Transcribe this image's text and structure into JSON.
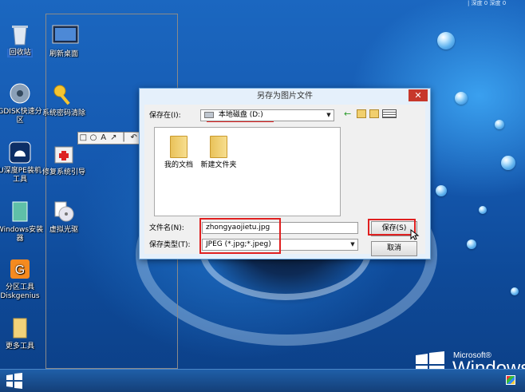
{
  "topbar": {
    "text": "| 深度 0 深度 0"
  },
  "desktop_icons": [
    {
      "label": "回收站",
      "icon": "recycle-bin-icon"
    },
    {
      "label": "刷新桌面",
      "icon": "refresh-desktop-icon"
    },
    {
      "label": "GDISK快速分区",
      "icon": "gdisk-icon"
    },
    {
      "label": "系统密码清除",
      "icon": "key-icon"
    },
    {
      "label": "U深度PE装机工具",
      "icon": "pe-installer-icon"
    },
    {
      "label": "修复系统引导",
      "icon": "repair-boot-icon"
    },
    {
      "label": "Windows安装器",
      "icon": "windows-installer-icon"
    },
    {
      "label": "虚拟光驱",
      "icon": "virtual-drive-icon"
    },
    {
      "label": "分区工具Diskgenius",
      "icon": "diskgenius-icon"
    },
    {
      "label": "更多工具",
      "icon": "more-tools-icon"
    }
  ],
  "toolbar": {
    "tools": [
      "□",
      "○",
      "A",
      "↗",
      "│",
      "↶"
    ]
  },
  "dialog": {
    "title": "另存为图片文件",
    "close": "✕",
    "save_in_label": "保存在(I):",
    "save_in_value": "本地磁盘 (D:)",
    "files": [
      "我的文档",
      "新建文件夹"
    ],
    "filename_label": "文件名(N):",
    "filename_value": "zhongyaojietu.jpg",
    "filetype_label": "保存类型(T):",
    "filetype_value": "JPEG (*.jpg;*.jpeg)",
    "save_button": "保存(S)",
    "cancel_button": "取消"
  },
  "branding": {
    "microsoft": "Microsoft®",
    "windows": "Windows"
  },
  "colors": {
    "accent_red": "#e02020",
    "close_red": "#c7382b",
    "dialog_border": "#6aa5dd"
  }
}
